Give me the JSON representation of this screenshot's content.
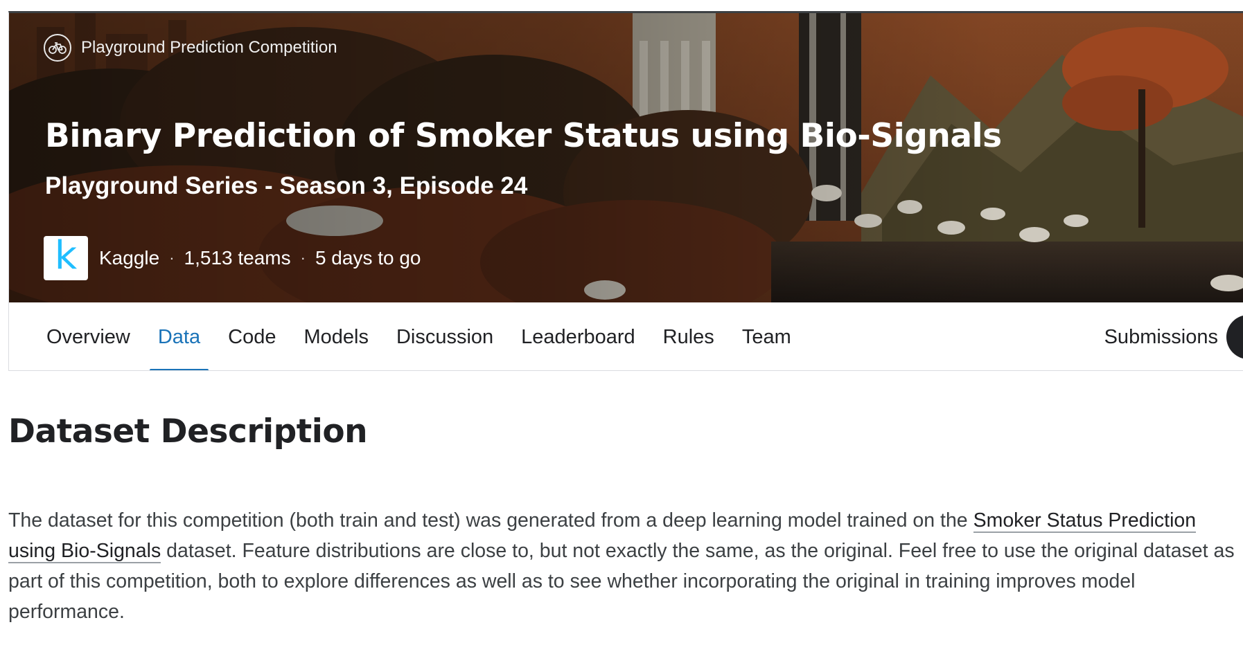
{
  "banner": {
    "competition_type": "Playground Prediction Competition",
    "type_icon": "bicycle-icon",
    "title": "Binary Prediction of Smoker Status using Bio-Signals",
    "subtitle": "Playground Series - Season 3, Episode 24",
    "host_logo_letter": "k",
    "host_name": "Kaggle",
    "separator": "·",
    "teams": "1,513 teams",
    "deadline": "5 days to go"
  },
  "tabs": {
    "items": [
      {
        "label": "Overview",
        "active": false
      },
      {
        "label": "Data",
        "active": true
      },
      {
        "label": "Code",
        "active": false
      },
      {
        "label": "Models",
        "active": false
      },
      {
        "label": "Discussion",
        "active": false
      },
      {
        "label": "Leaderboard",
        "active": false
      },
      {
        "label": "Rules",
        "active": false
      },
      {
        "label": "Team",
        "active": false
      }
    ],
    "submissions": "Submissions"
  },
  "main": {
    "section_title": "Dataset Description",
    "description_before": "The dataset for this competition (both train and test) was generated from a deep learning model trained on the ",
    "description_link": "Smoker Status Prediction using Bio-Signals",
    "description_after": " dataset. Feature distributions are close to, but not exactly the same, as the original. Feel free to use the original dataset as part of this competition, both to explore differences as well as to see whether incorporating the original in training improves model performance."
  },
  "colors": {
    "accent": "#1a73b8",
    "kaggle_blue": "#20beff",
    "text": "#202124"
  }
}
